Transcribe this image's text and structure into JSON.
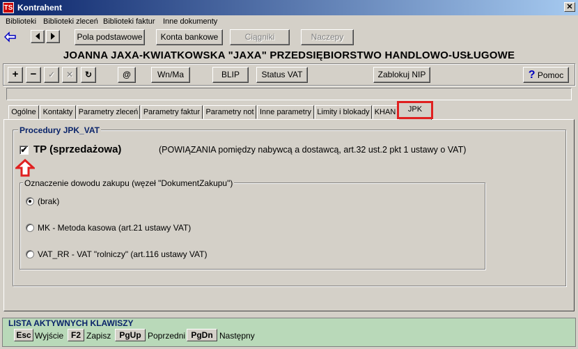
{
  "window": {
    "title": "Kontrahent",
    "app_icon_text": "TS",
    "close_glyph": "✕"
  },
  "menu": [
    "Biblioteki",
    "Biblioteki zleceń",
    "Biblioteki faktur",
    "Inne dokumenty"
  ],
  "toolbar1": {
    "back_icon": "back-arrow-icon",
    "buttons": [
      "Pola podstawowe",
      "Konta bankowe",
      "Ciągniki",
      "Naczepy"
    ]
  },
  "company_name": "JOANNA JAXA-KWIATKOWSKA \"JAXA\" PRZEDSIĘBIORSTWO HANDLOWO-USŁUGOWE",
  "toolbar2": {
    "icons": [
      "+",
      "−",
      "✓",
      "✕",
      "↻",
      "@"
    ],
    "buttons": [
      "Wn/Ma",
      "BLIP",
      "Status VAT",
      "Zablokuj NIP"
    ],
    "help_label": "Pomoc",
    "help_glyph": "?"
  },
  "tabs": [
    "Ogólne",
    "Kontakty",
    "Parametry zleceń",
    "Parametry faktur",
    "Parametry not",
    "Inne parametry",
    "Limity i blokady",
    "KHAN",
    "JPK"
  ],
  "active_tab": "JPK",
  "highlight_color": "#e02020",
  "jpk": {
    "group_title": "Procedury JPK_VAT",
    "tp_label": "TP (sprzedażowa)",
    "tp_checked": true,
    "tp_description": "(POWIĄZANIA pomiędzy nabywcą a dostawcą, art.32 ust.2 pkt 1 ustawy o VAT)",
    "purchase_group_title": "Oznaczenie dowodu zakupu (węzeł \"DokumentZakupu\")",
    "options": [
      {
        "label": "(brak)",
        "selected": true
      },
      {
        "label": "MK - Metoda kasowa (art.21 ustawy VAT)",
        "selected": false
      },
      {
        "label": "VAT_RR - VAT \"rolniczy\" (art.116 ustawy VAT)",
        "selected": false
      }
    ]
  },
  "shortcuts": {
    "title": "LISTA AKTYWNYCH KLAWISZY",
    "keys": [
      {
        "key": "Esc",
        "action": "Wyjście"
      },
      {
        "key": "F2",
        "action": "Zapisz"
      },
      {
        "key": "PgUp",
        "action": "Poprzedni"
      },
      {
        "key": "PgDn",
        "action": "Następny"
      }
    ]
  }
}
